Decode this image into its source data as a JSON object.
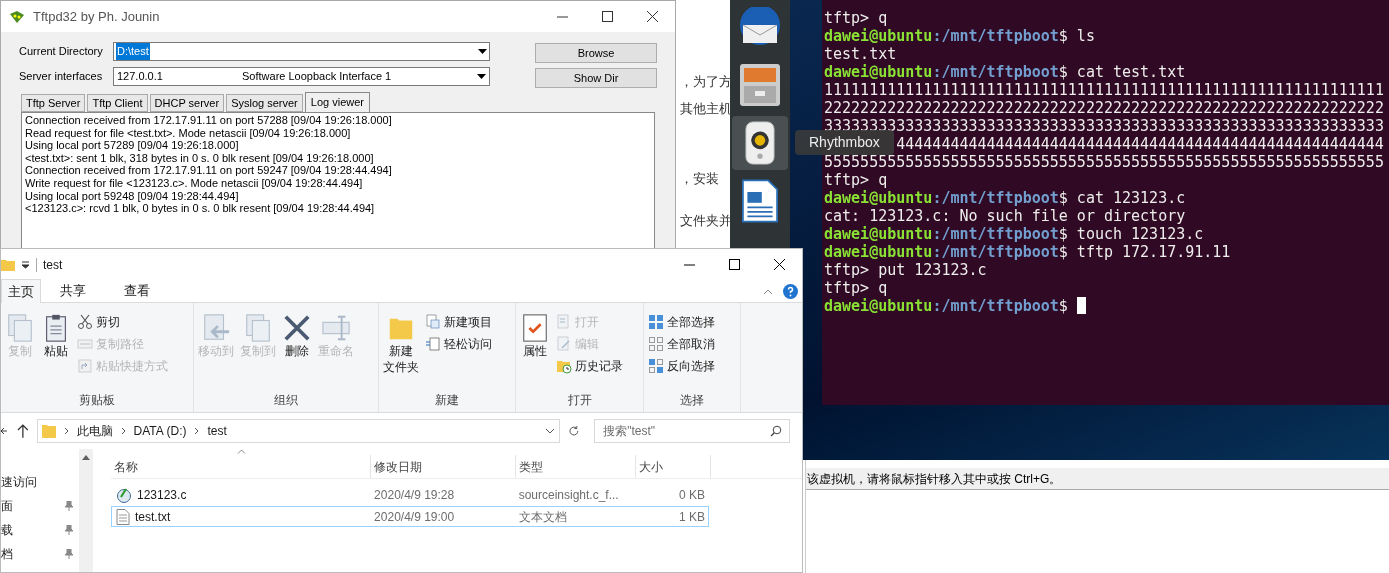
{
  "background_document": {
    "fragments": [
      "，为了方",
      "其他主机",
      "，安装",
      "文件夹并"
    ]
  },
  "tftpd": {
    "title": "Tftpd32 by Ph. Jounin",
    "current_directory": {
      "label": "Current Directory",
      "value": "D:\\test"
    },
    "server_interfaces": {
      "label": "Server interfaces",
      "address": "127.0.0.1",
      "name": "Software Loopback Interface 1"
    },
    "buttons": [
      "Browse",
      "Show Dir"
    ],
    "tabs": [
      {
        "label": "Tftp Server",
        "selected": false
      },
      {
        "label": "Tftp Client",
        "selected": false
      },
      {
        "label": "DHCP server",
        "selected": false
      },
      {
        "label": "Syslog server",
        "selected": false
      },
      {
        "label": "Log viewer",
        "selected": true
      }
    ],
    "log": [
      "Connection received from 172.17.91.11 on port 57288 [09/04 19:26:18.000]",
      "Read request for file <test.txt>. Mode netascii [09/04 19:26:18.000]",
      "Using local port 57289 [09/04 19:26:18.000]",
      "<test.txt>: sent 1 blk, 318 bytes in 0 s. 0 blk resent [09/04 19:26:18.000]",
      "Connection received from 172.17.91.11 on port 59247 [09/04 19:28:44.494]",
      "Write request for file <123123.c>. Mode netascii [09/04 19:28:44.494]",
      "Using local port 59248 [09/04 19:28:44.494]",
      "<123123.c>: rcvd 1 blk, 0 bytes in 0 s. 0 blk resent [09/04 19:28:44.494]"
    ]
  },
  "dock": {
    "tooltip": "Rhythmbox",
    "apps": [
      {
        "kind": "mail",
        "selected": false
      },
      {
        "kind": "files",
        "selected": false
      },
      {
        "kind": "music",
        "selected": true
      },
      {
        "kind": "writer",
        "selected": false
      }
    ]
  },
  "terminal": {
    "lines": [
      {
        "kind": "output",
        "text": "tftp> q"
      },
      {
        "kind": "prompt",
        "user": "dawei@ubuntu",
        "path": ":/mnt/tftpboot",
        "command": "$ ls"
      },
      {
        "kind": "output",
        "text": "test.txt"
      },
      {
        "kind": "prompt",
        "user": "dawei@ubuntu",
        "path": ":/mnt/tftpboot",
        "command": "$ cat test.txt"
      },
      {
        "kind": "output",
        "text": "11111111111111111111111111111111111111111111111111111111111111"
      },
      {
        "kind": "output",
        "text": "22222222222222222222222222222222222222222222222222222222222222"
      },
      {
        "kind": "output",
        "text": "33333333333333333333333333333333333333333333333333333333333333"
      },
      {
        "kind": "covered",
        "text": "444444444444444444444444444444444444444444444444444444"
      },
      {
        "kind": "output",
        "text": "55555555555555555555555555555555555555555555555555555555555555"
      },
      {
        "kind": "output",
        "text": "tftp> q"
      },
      {
        "kind": "prompt",
        "user": "dawei@ubuntu",
        "path": ":/mnt/tftpboot",
        "command": "$ cat 123123.c"
      },
      {
        "kind": "output",
        "text": "cat: 123123.c: No such file or directory"
      },
      {
        "kind": "prompt",
        "user": "dawei@ubuntu",
        "path": ":/mnt/tftpboot",
        "command": "$ touch 123123.c"
      },
      {
        "kind": "prompt",
        "user": "dawei@ubuntu",
        "path": ":/mnt/tftpboot",
        "command": "$ tftp 172.17.91.11"
      },
      {
        "kind": "output",
        "text": "tftp> put 123123.c"
      },
      {
        "kind": "output",
        "text": "tftp> q"
      },
      {
        "kind": "prompt",
        "user": "dawei@ubuntu",
        "path": ":/mnt/tftpboot",
        "command": "$ ",
        "cursor": true
      }
    ]
  },
  "vm_status": "该虚拟机，请将鼠标指针移入其中或按 Ctrl+G。",
  "explorer": {
    "title": "test",
    "tabs": [
      {
        "label": "主页",
        "selected": true
      },
      {
        "label": "共享",
        "selected": false
      },
      {
        "label": "查看",
        "selected": false
      }
    ],
    "ribbon": [
      {
        "label": "剪贴板",
        "commands": [
          {
            "kind": "large",
            "label": "复制",
            "disabled": true
          },
          {
            "kind": "large",
            "label": "粘贴",
            "disabled": false
          },
          {
            "kind": "small",
            "label": "剪切",
            "disabled": false
          },
          {
            "kind": "small",
            "label": "复制路径",
            "disabled": true
          },
          {
            "kind": "small",
            "label": "粘贴快捷方式",
            "disabled": true
          }
        ]
      },
      {
        "label": "组织",
        "commands": [
          {
            "kind": "large",
            "label": "移动到",
            "disabled": true
          },
          {
            "kind": "large",
            "label": "复制到",
            "disabled": true
          },
          {
            "kind": "large",
            "label": "删除",
            "disabled": false
          },
          {
            "kind": "large",
            "label": "重命名",
            "disabled": true
          }
        ]
      },
      {
        "label": "新建",
        "commands": [
          {
            "kind": "large",
            "label": "新建",
            "label_2": "文件夹",
            "disabled": false
          },
          {
            "kind": "small",
            "label": "新建项目",
            "disabled": false
          },
          {
            "kind": "small",
            "label": "轻松访问",
            "disabled": false
          }
        ]
      },
      {
        "label": "打开",
        "commands": [
          {
            "kind": "large",
            "label": "属性",
            "disabled": false
          },
          {
            "kind": "small",
            "label": "打开",
            "disabled": true
          },
          {
            "kind": "small",
            "label": "编辑",
            "disabled": true
          },
          {
            "kind": "small",
            "label": "历史记录",
            "disabled": false
          }
        ]
      },
      {
        "label": "选择",
        "commands": [
          {
            "kind": "small",
            "label": "全部选择",
            "disabled": false
          },
          {
            "kind": "small",
            "label": "全部取消",
            "disabled": false
          },
          {
            "kind": "small",
            "label": "反向选择",
            "disabled": false
          }
        ]
      }
    ],
    "breadcrumb": [
      "此电脑",
      "DATA (D:)",
      "test"
    ],
    "search": {
      "placeholder": "搜索\"test\""
    },
    "nav": [
      "速访问",
      "面",
      "载",
      "档"
    ],
    "columns": [
      "名称",
      "修改日期",
      "类型",
      "大小"
    ],
    "files": [
      {
        "kind": "source",
        "name": "123123.c",
        "modified": "2020/4/9 19:28",
        "type": "sourceinsight.c_f...",
        "size": "0 KB",
        "focused": false
      },
      {
        "kind": "text",
        "name": "test.txt",
        "modified": "2020/4/9 19:00",
        "type": "文本文档",
        "size": "1 KB",
        "focused": true
      }
    ]
  }
}
